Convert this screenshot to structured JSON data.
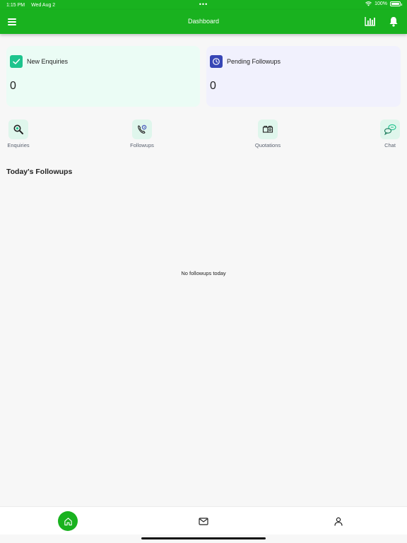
{
  "status_bar": {
    "time": "1:15 PM",
    "date": "Wed Aug 2",
    "dots": "•••",
    "battery": "100%",
    "battery_level": 1.0
  },
  "app_bar": {
    "title": "Dashboard",
    "color": "#19b21f",
    "menu_icon": "hamburger-menu-icon",
    "chart_icon": "bar-chart-icon",
    "bell_icon": "bell-icon"
  },
  "cards": [
    {
      "label": "New Enquiries",
      "value": "0",
      "icon": "check-icon",
      "color": "#1dc48d"
    },
    {
      "label": "Pending Followups",
      "value": "0",
      "icon": "clock-icon",
      "color": "#3746b6"
    }
  ],
  "quick_actions": [
    {
      "label": "Enquiries",
      "icon": "magnifier-icon"
    },
    {
      "label": "Followups",
      "icon": "phone-icon"
    },
    {
      "label": "Quotations",
      "icon": "documents-icon"
    },
    {
      "label": "Chat",
      "icon": "chat-bubbles-icon"
    }
  ],
  "section": {
    "title": "Today's Followups",
    "empty_message": "No followups today"
  },
  "bottom_nav": [
    {
      "name": "home",
      "icon": "home-icon",
      "active": true
    },
    {
      "name": "messages",
      "icon": "mail-icon",
      "active": false
    },
    {
      "name": "profile",
      "icon": "user-icon",
      "active": false
    }
  ]
}
